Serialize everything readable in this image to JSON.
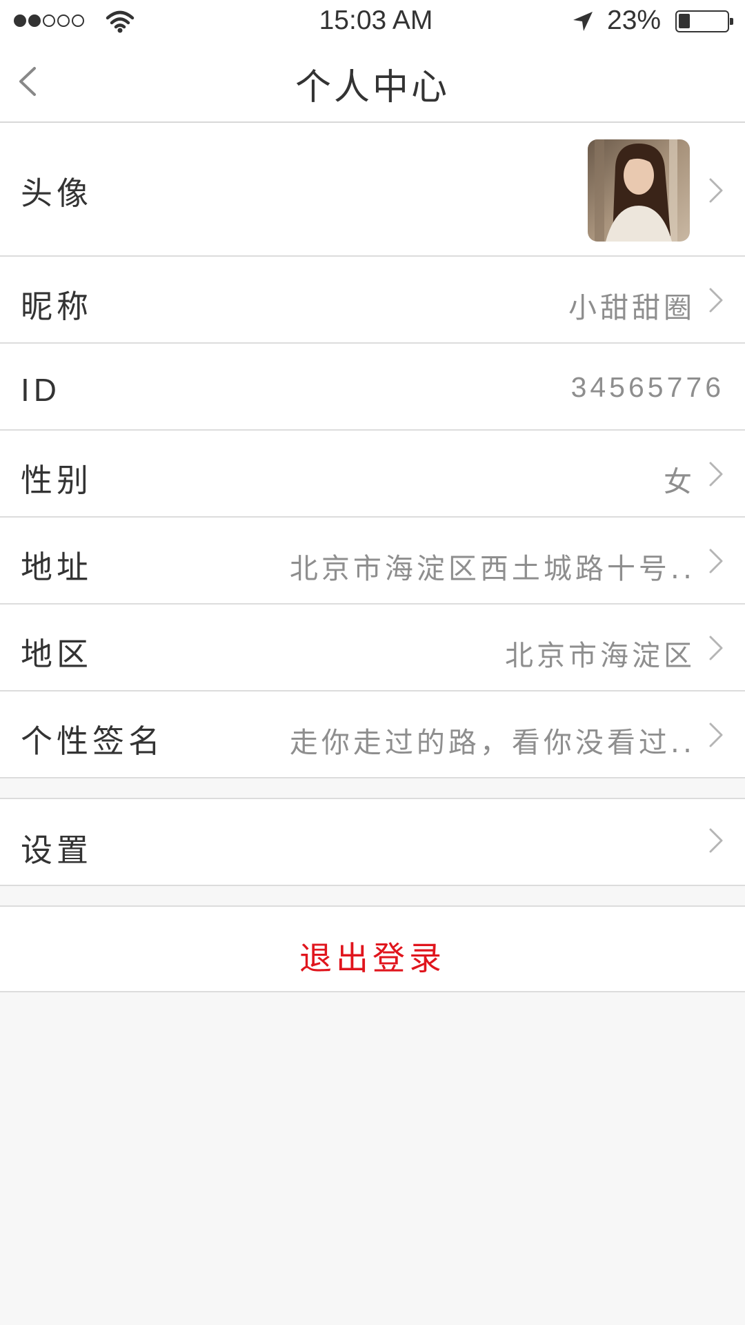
{
  "status_bar": {
    "time": "15:03 AM",
    "battery_percent": "23%",
    "battery_level": 0.23,
    "signal_bars": 2,
    "signal_total": 5,
    "icons": [
      "signal-dots-icon",
      "wifi-icon",
      "location-arrow-icon",
      "battery-icon"
    ]
  },
  "nav": {
    "title": "个人中心",
    "back_icon": "chevron-left-icon"
  },
  "profile": {
    "avatar_label": "头像",
    "nickname_label": "昵称",
    "nickname_value": "小甜甜圈",
    "id_label": "ID",
    "id_value": "34565776",
    "gender_label": "性别",
    "gender_value": "女",
    "address_label": "地址",
    "address_value": "北京市海淀区西土城路十号..",
    "region_label": "地区",
    "region_value": "北京市海淀区",
    "signature_label": "个性签名",
    "signature_value": "走你走过的路，看你没看过..",
    "chevron_icon": "chevron-right-icon"
  },
  "settings": {
    "label": "设置"
  },
  "logout": {
    "label": "退出登录",
    "color": "#e0151d"
  },
  "colors": {
    "background": "#f7f7f7",
    "row_background": "#ffffff",
    "value_text": "#8e8e8e",
    "divider": "#dcdcdc"
  }
}
